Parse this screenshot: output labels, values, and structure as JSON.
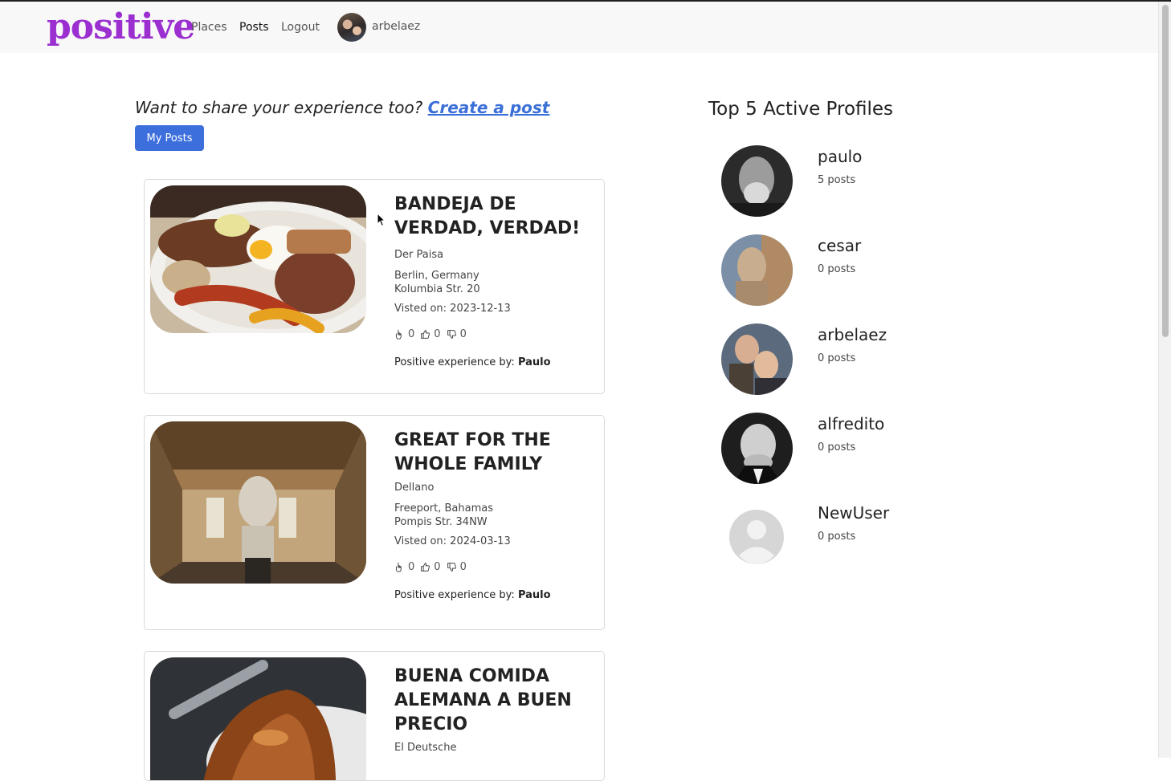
{
  "navbar": {
    "brand": "positive",
    "links": [
      "Places",
      "Posts",
      "Logout"
    ],
    "active_link": "Posts",
    "username": "arbelaez"
  },
  "share": {
    "prompt": "Want to share your experience too?",
    "link": "Create a post",
    "my_posts_button": "My Posts"
  },
  "posts": [
    {
      "title": "BANDEJA DE VERDAD, VERDAD!",
      "place": "Der Paisa",
      "city": "Berlin, Germany",
      "street": "Kolumbia Str. 20",
      "visited": "Visted on: 2023-12-13",
      "clicks": "0",
      "likes": "0",
      "dislikes": "0",
      "byline_prefix": "Positive experience by:",
      "author": "Paulo"
    },
    {
      "title": "GREAT FOR THE WHOLE FAMILY",
      "place": "Dellano",
      "city": "Freeport, Bahamas",
      "street": "Pompis Str. 34NW",
      "visited": "Visted on: 2024-03-13",
      "clicks": "0",
      "likes": "0",
      "dislikes": "0",
      "byline_prefix": "Positive experience by:",
      "author": "Paulo"
    },
    {
      "title": "BUENA COMIDA ALEMANA A BUEN PRECIO",
      "place": "El Deutsche"
    }
  ],
  "top_profiles": {
    "title": "Top 5 Active Profiles",
    "items": [
      {
        "name": "paulo",
        "posts": "5 posts"
      },
      {
        "name": "cesar",
        "posts": "0 posts"
      },
      {
        "name": "arbelaez",
        "posts": "0 posts"
      },
      {
        "name": "alfredito",
        "posts": "0 posts"
      },
      {
        "name": "NewUser",
        "posts": "0 posts"
      }
    ]
  },
  "colors": {
    "brand": "#9b2fd0",
    "primary_button": "#3d6fdc",
    "link": "#3b6fd8"
  }
}
